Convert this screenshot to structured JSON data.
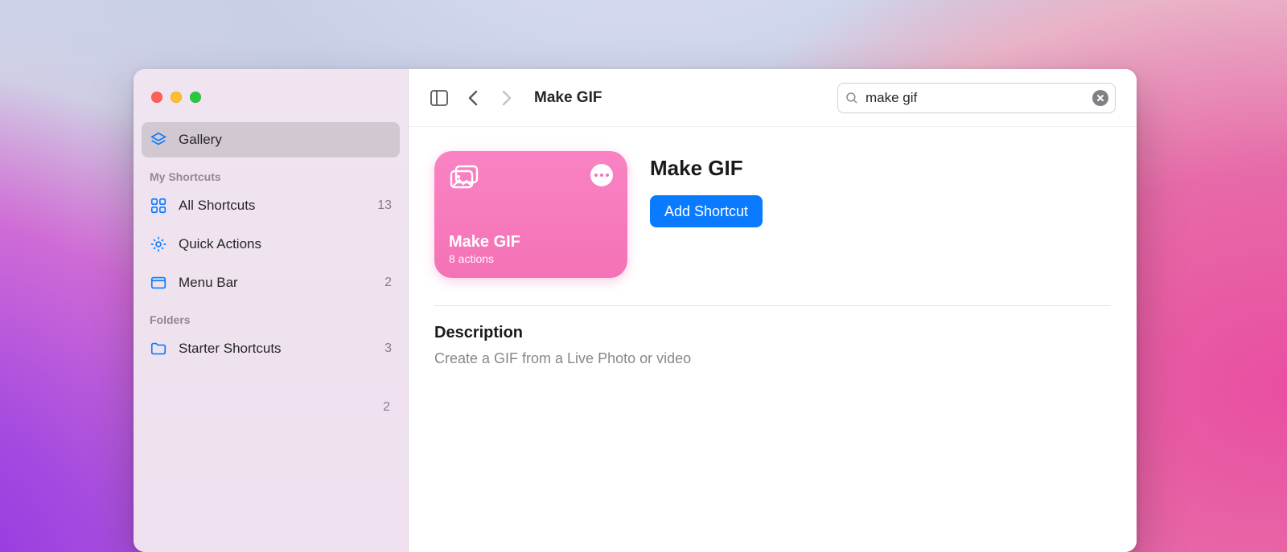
{
  "toolbar": {
    "title": "Make GIF",
    "search_value": "make gif"
  },
  "sidebar": {
    "gallery_label": "Gallery",
    "heading_myshortcuts": "My Shortcuts",
    "heading_folders": "Folders",
    "items": {
      "all": {
        "label": "All Shortcuts",
        "count": "13"
      },
      "quick": {
        "label": "Quick Actions",
        "count": ""
      },
      "menu": {
        "label": "Menu Bar",
        "count": "2"
      },
      "starter": {
        "label": "Starter Shortcuts",
        "count": "3"
      }
    },
    "orphan_count": "2"
  },
  "tile": {
    "name": "Make GIF",
    "subtitle": "8 actions"
  },
  "detail": {
    "title": "Make GIF",
    "add_label": "Add Shortcut",
    "description_heading": "Description",
    "description_body": "Create a GIF from a Live Photo or video"
  }
}
